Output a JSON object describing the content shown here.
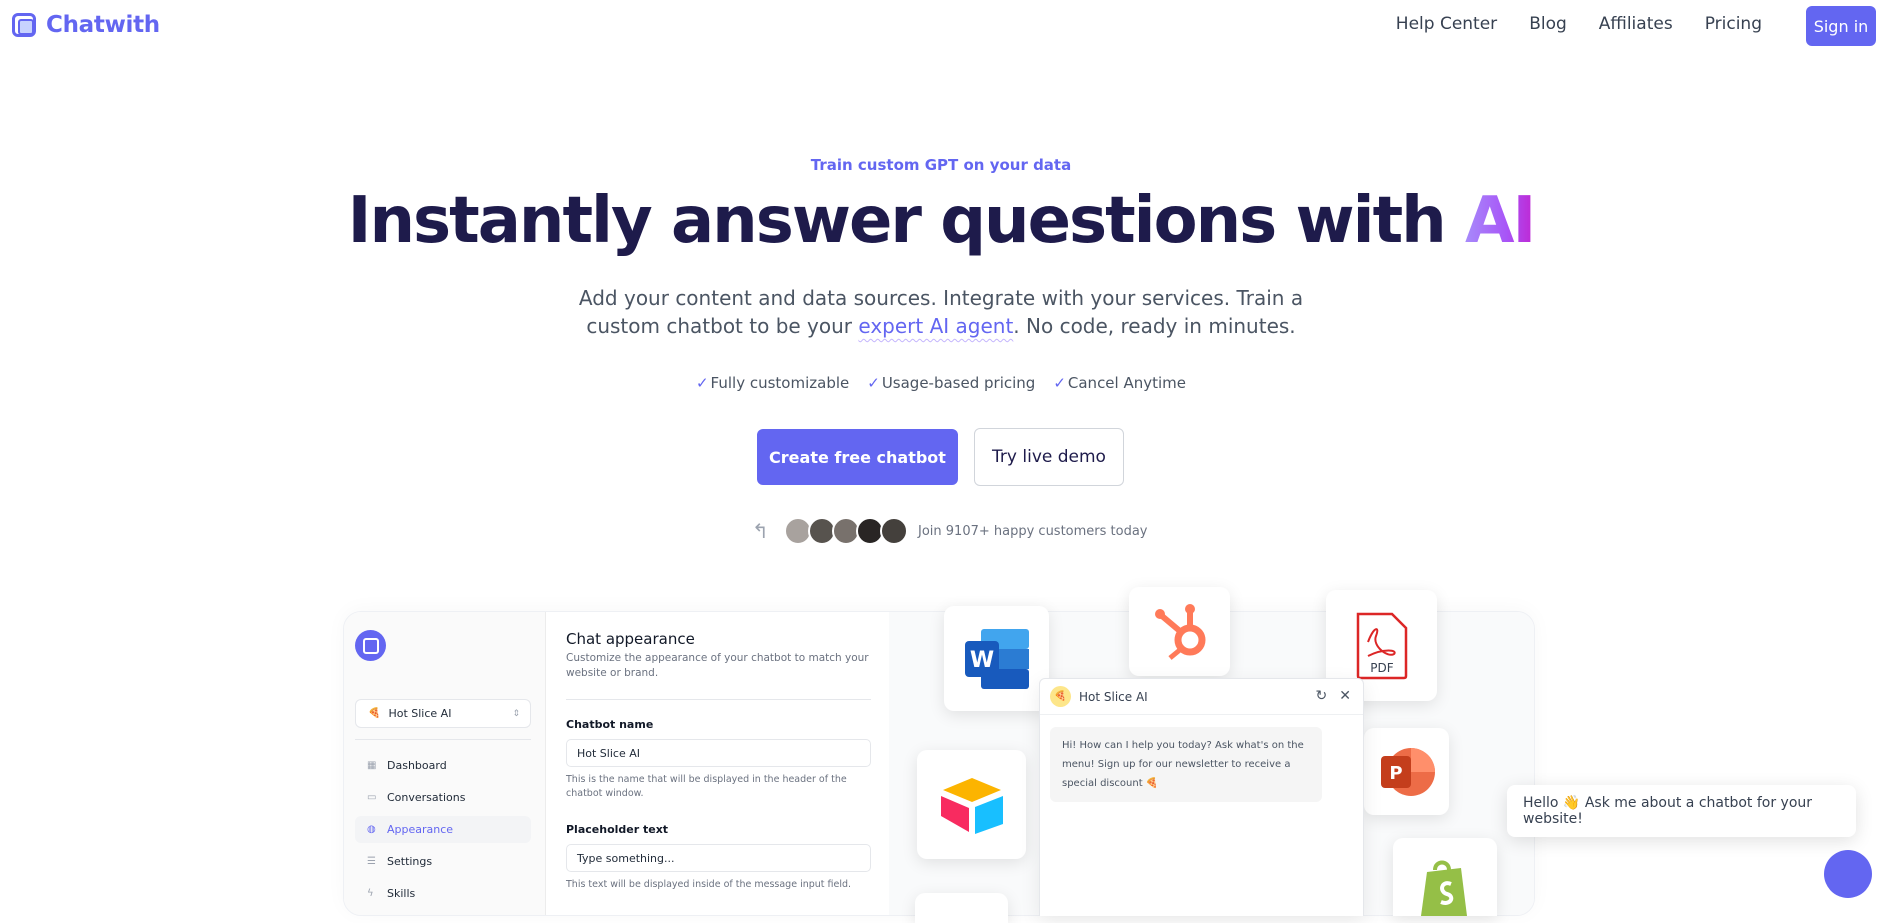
{
  "nav": {
    "logo_text": "Chatwith",
    "links": [
      "Help Center",
      "Blog",
      "Affiliates",
      "Pricing"
    ],
    "signin_label": "Sign in"
  },
  "hero": {
    "eyebrow": "Train custom GPT on your data",
    "title_main": "Instantly answer questions with ",
    "title_accent": "AI",
    "subtitle_before": "Add your content and data sources. Integrate with your services. Train a custom chatbot to be your ",
    "subtitle_highlight": "expert AI agent",
    "subtitle_after": ". No code, ready in minutes.",
    "checks": [
      "Fully customizable",
      "Usage-based pricing",
      "Cancel Anytime"
    ],
    "check_mark": "✓",
    "cta_primary": "Create free chatbot",
    "cta_secondary": "Try live demo",
    "social_proof": "Join 9107+ happy customers today",
    "avatar_colors": [
      "#a8a29e",
      "#57534e",
      "#78716c",
      "#292524",
      "#44403c"
    ]
  },
  "mockup": {
    "sidebar": {
      "bot_name": "Hot Slice AI",
      "menu": [
        {
          "label": "Dashboard",
          "icon": "grid-icon",
          "glyph": "▦",
          "active": false
        },
        {
          "label": "Conversations",
          "icon": "inbox-icon",
          "glyph": "▭",
          "active": false
        },
        {
          "label": "Appearance",
          "icon": "palette-icon",
          "glyph": "◍",
          "active": true
        },
        {
          "label": "Settings",
          "icon": "sliders-icon",
          "glyph": "☰",
          "active": false
        },
        {
          "label": "Skills",
          "icon": "bolt-icon",
          "glyph": "ϟ",
          "active": false
        }
      ]
    },
    "form": {
      "title": "Chat appearance",
      "description": "Customize the appearance of your chatbot to match your website or brand.",
      "name_label": "Chatbot name",
      "name_value": "Hot Slice AI",
      "name_help": "This is the name that will be displayed in the header of the chatbot window.",
      "placeholder_label": "Placeholder text",
      "placeholder_value": "Type something...",
      "placeholder_help": "This text will be displayed inside of the message input field."
    },
    "chat": {
      "name": "Hot Slice AI",
      "message": "Hi! How can I help you today? Ask what's on the menu! Sign up for our newsletter to receive a special discount 🍕"
    },
    "integrations": [
      "word-icon",
      "hubspot-icon",
      "pdf-icon",
      "airtable-icon",
      "powerpoint-icon",
      "shopify-icon"
    ],
    "pdf_label": "PDF",
    "word_letter": "W",
    "ppt_letter": "P"
  },
  "widget": {
    "bubble_text": "Hello 👋 Ask me about a chatbot for your website!"
  },
  "colors": {
    "accent": "#6366f1",
    "heading": "#1e1b4b"
  }
}
